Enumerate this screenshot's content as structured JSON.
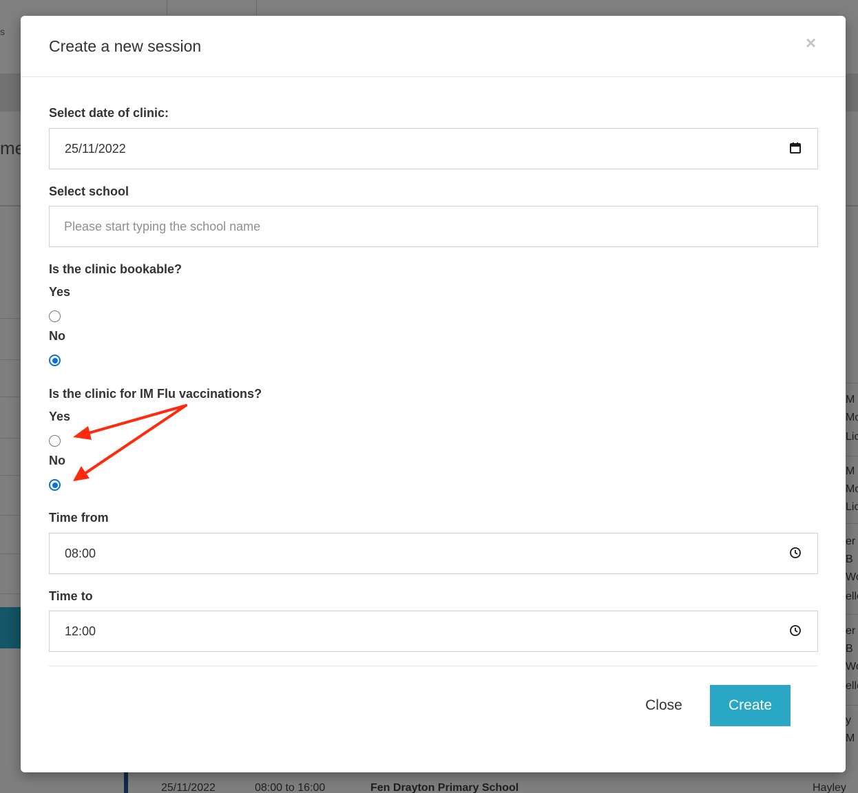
{
  "background": {
    "header_fragment": "me",
    "edge_fragment": "s",
    "bottom_row": {
      "date": "25/11/2022",
      "time": "08:00 to 16:00",
      "school": "Fen Drayton Primary School",
      "person": "Hayley"
    },
    "right_fragments": [
      "M",
      "Mo",
      "Lic",
      "M",
      "Mo",
      "Lic",
      "er",
      "B",
      "Wo",
      "elle",
      "er",
      "B",
      "Wo",
      "elle",
      "y",
      "M"
    ]
  },
  "modal": {
    "title": "Create a new session",
    "close_icon": "×",
    "date": {
      "label": "Select date of clinic:",
      "value": "25/11/2022",
      "icon": "calendar-icon"
    },
    "school": {
      "label": "Select school",
      "placeholder": "Please start typing the school name"
    },
    "bookable": {
      "question": "Is the clinic bookable?",
      "yes_label": "Yes",
      "no_label": "No",
      "selected": "No"
    },
    "im_flu": {
      "question": "Is the clinic for IM Flu vaccinations?",
      "yes_label": "Yes",
      "no_label": "No",
      "selected": "No"
    },
    "time_from": {
      "label": "Time from",
      "value": "08:00",
      "icon": "clock-icon"
    },
    "time_to": {
      "label": "Time to",
      "value": "12:00",
      "icon": "clock-icon"
    },
    "buttons": {
      "close": "Close",
      "create": "Create"
    }
  },
  "colors": {
    "create_button": "#2ba7c6",
    "radio_checked": "#0a6ee8",
    "annotation_arrow": "#ff2a0d"
  }
}
